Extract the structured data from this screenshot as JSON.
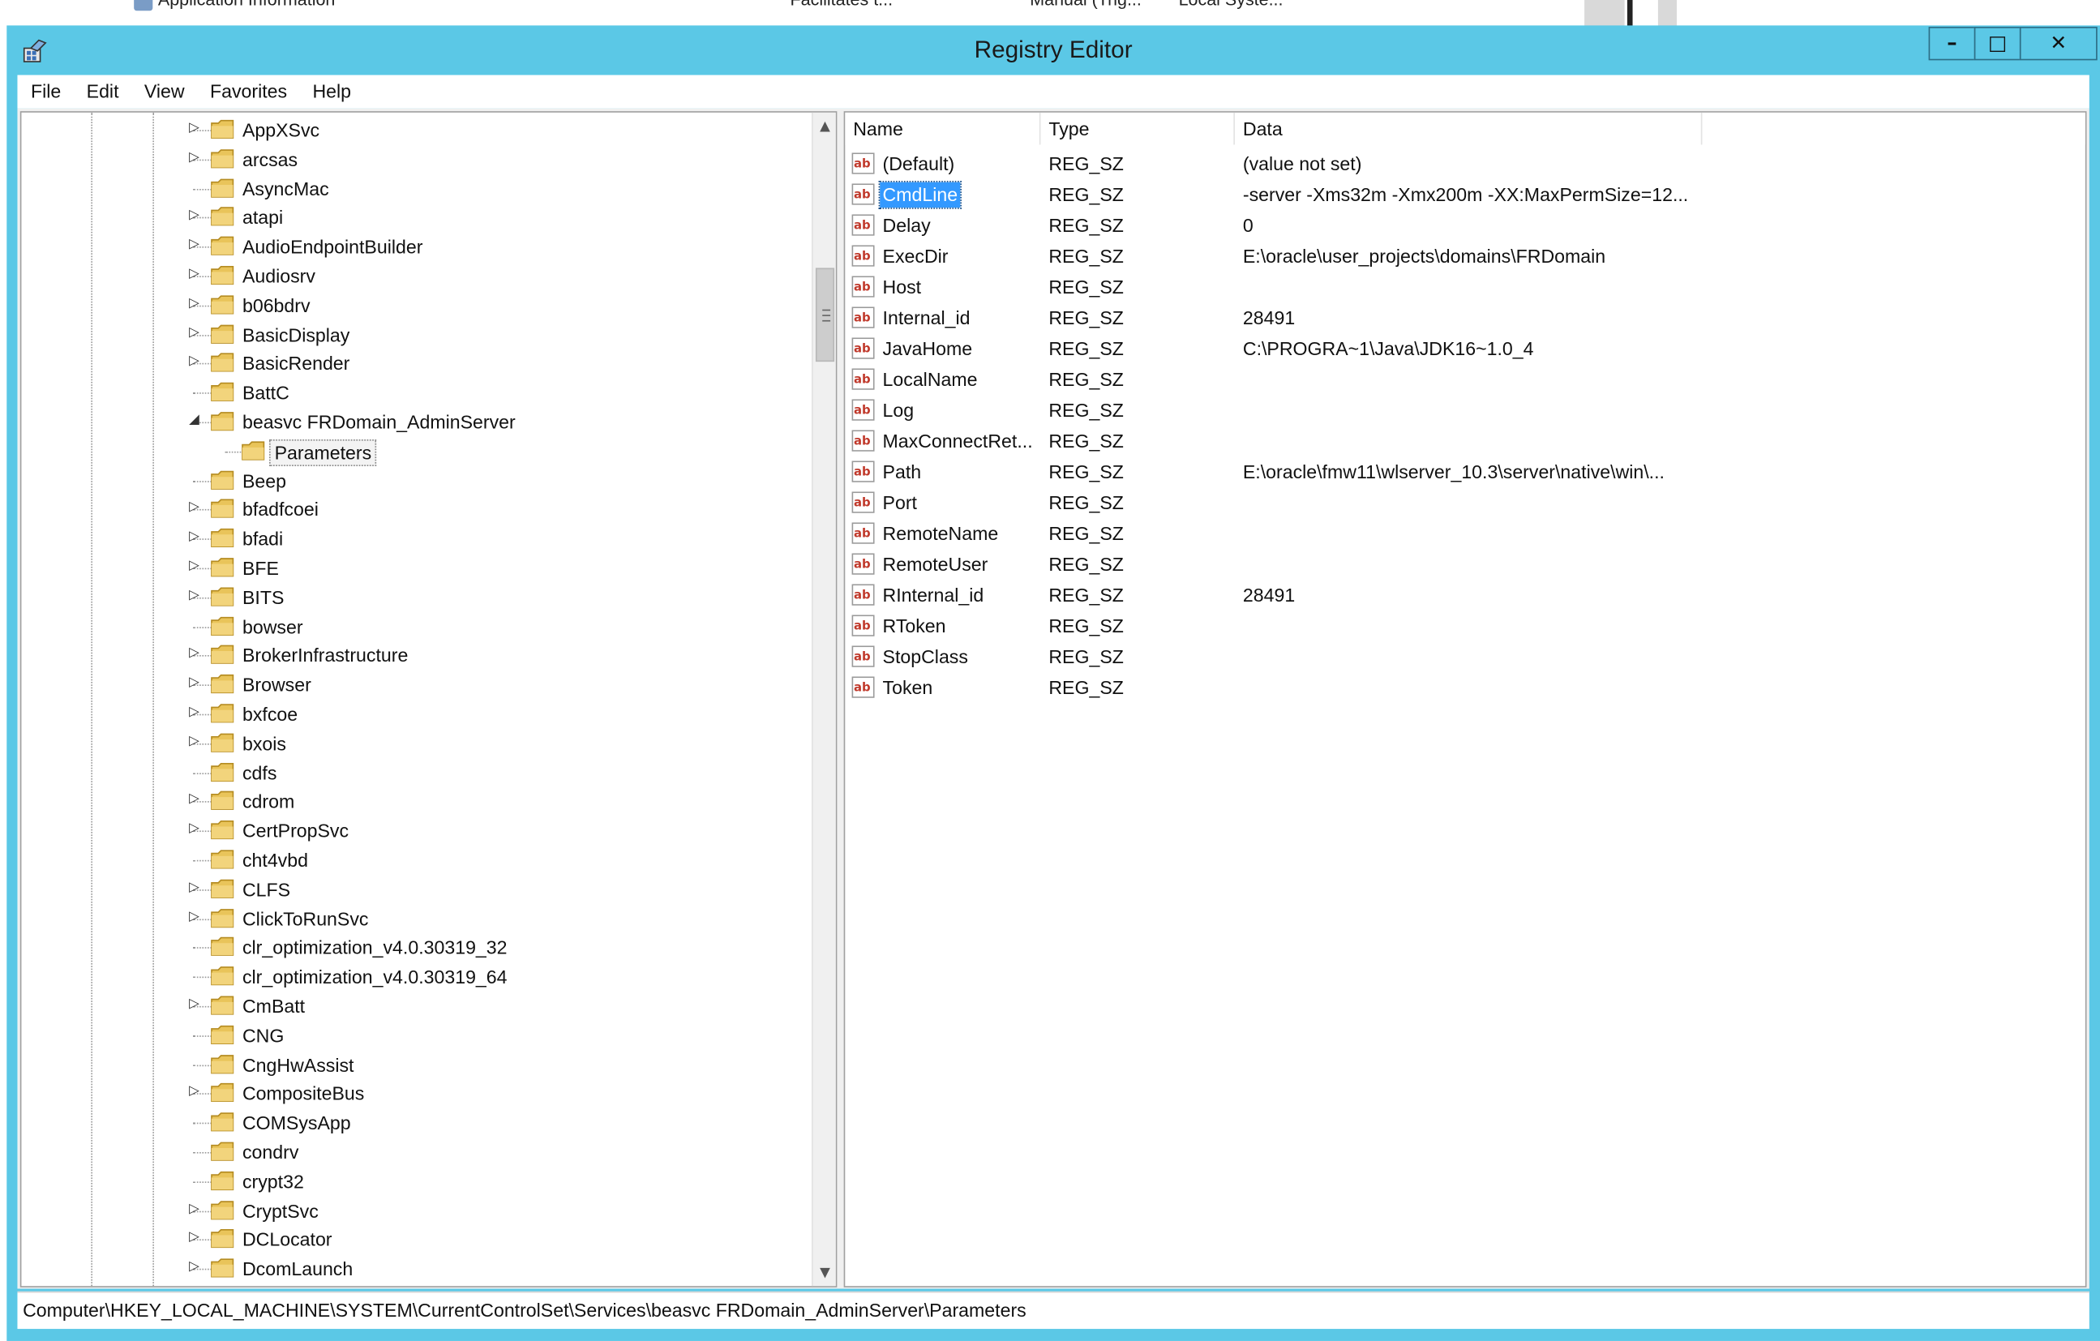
{
  "background_app": {
    "items": [
      "Application Information",
      "Facilitates t...",
      "Manual (Trig...",
      "Local Syste..."
    ]
  },
  "window": {
    "title": "Registry Editor",
    "controls": {
      "minimize": "–",
      "maximize": "□",
      "close": "✕"
    },
    "accent": "#5bc8e6"
  },
  "menu": [
    "File",
    "Edit",
    "View",
    "Favorites",
    "Help"
  ],
  "tree": {
    "items": [
      {
        "label": "AppXSvc",
        "expandable": true
      },
      {
        "label": "arcsas",
        "expandable": true
      },
      {
        "label": "AsyncMac",
        "expandable": false
      },
      {
        "label": "atapi",
        "expandable": true
      },
      {
        "label": "AudioEndpointBuilder",
        "expandable": true
      },
      {
        "label": "Audiosrv",
        "expandable": true
      },
      {
        "label": "b06bdrv",
        "expandable": true
      },
      {
        "label": "BasicDisplay",
        "expandable": true
      },
      {
        "label": "BasicRender",
        "expandable": true
      },
      {
        "label": "BattC",
        "expandable": false
      },
      {
        "label": "beasvc FRDomain_AdminServer",
        "expandable": true,
        "expanded": true
      },
      {
        "label": "Parameters",
        "expandable": false,
        "child": true,
        "selected": true
      },
      {
        "label": "Beep",
        "expandable": false
      },
      {
        "label": "bfadfcoei",
        "expandable": true
      },
      {
        "label": "bfadi",
        "expandable": true
      },
      {
        "label": "BFE",
        "expandable": true
      },
      {
        "label": "BITS",
        "expandable": true
      },
      {
        "label": "bowser",
        "expandable": false
      },
      {
        "label": "BrokerInfrastructure",
        "expandable": true
      },
      {
        "label": "Browser",
        "expandable": true
      },
      {
        "label": "bxfcoe",
        "expandable": true
      },
      {
        "label": "bxois",
        "expandable": true
      },
      {
        "label": "cdfs",
        "expandable": false
      },
      {
        "label": "cdrom",
        "expandable": true
      },
      {
        "label": "CertPropSvc",
        "expandable": true
      },
      {
        "label": "cht4vbd",
        "expandable": false
      },
      {
        "label": "CLFS",
        "expandable": true
      },
      {
        "label": "ClickToRunSvc",
        "expandable": true
      },
      {
        "label": "clr_optimization_v4.0.30319_32",
        "expandable": false
      },
      {
        "label": "clr_optimization_v4.0.30319_64",
        "expandable": false
      },
      {
        "label": "CmBatt",
        "expandable": true
      },
      {
        "label": "CNG",
        "expandable": false
      },
      {
        "label": "CngHwAssist",
        "expandable": false
      },
      {
        "label": "CompositeBus",
        "expandable": true
      },
      {
        "label": "COMSysApp",
        "expandable": false
      },
      {
        "label": "condrv",
        "expandable": false
      },
      {
        "label": "crypt32",
        "expandable": false
      },
      {
        "label": "CryptSvc",
        "expandable": true
      },
      {
        "label": "DCLocator",
        "expandable": true
      },
      {
        "label": "DcomLaunch",
        "expandable": true
      }
    ]
  },
  "list": {
    "columns": [
      "Name",
      "Type",
      "Data"
    ],
    "rows": [
      {
        "name": "(Default)",
        "type": "REG_SZ",
        "data": "(value not set)"
      },
      {
        "name": "CmdLine",
        "type": "REG_SZ",
        "data": "-server -Xms32m -Xmx200m -XX:MaxPermSize=12...",
        "selected": true
      },
      {
        "name": "Delay",
        "type": "REG_SZ",
        "data": "0"
      },
      {
        "name": "ExecDir",
        "type": "REG_SZ",
        "data": "E:\\oracle\\user_projects\\domains\\FRDomain"
      },
      {
        "name": "Host",
        "type": "REG_SZ",
        "data": ""
      },
      {
        "name": "Internal_id",
        "type": "REG_SZ",
        "data": "28491"
      },
      {
        "name": "JavaHome",
        "type": "REG_SZ",
        "data": "C:\\PROGRA~1\\Java\\JDK16~1.0_4"
      },
      {
        "name": "LocalName",
        "type": "REG_SZ",
        "data": ""
      },
      {
        "name": "Log",
        "type": "REG_SZ",
        "data": ""
      },
      {
        "name": "MaxConnectRet...",
        "type": "REG_SZ",
        "data": ""
      },
      {
        "name": "Path",
        "type": "REG_SZ",
        "data": "E:\\oracle\\fmw11\\wlserver_10.3\\server\\native\\win\\..."
      },
      {
        "name": "Port",
        "type": "REG_SZ",
        "data": ""
      },
      {
        "name": "RemoteName",
        "type": "REG_SZ",
        "data": ""
      },
      {
        "name": "RemoteUser",
        "type": "REG_SZ",
        "data": ""
      },
      {
        "name": "RInternal_id",
        "type": "REG_SZ",
        "data": "28491"
      },
      {
        "name": "RToken",
        "type": "REG_SZ",
        "data": ""
      },
      {
        "name": "StopClass",
        "type": "REG_SZ",
        "data": ""
      },
      {
        "name": "Token",
        "type": "REG_SZ",
        "data": ""
      }
    ],
    "value_icon": "string-value-icon"
  },
  "status": {
    "path": "Computer\\HKEY_LOCAL_MACHINE\\SYSTEM\\CurrentControlSet\\Services\\beasvc FRDomain_AdminServer\\Parameters"
  }
}
